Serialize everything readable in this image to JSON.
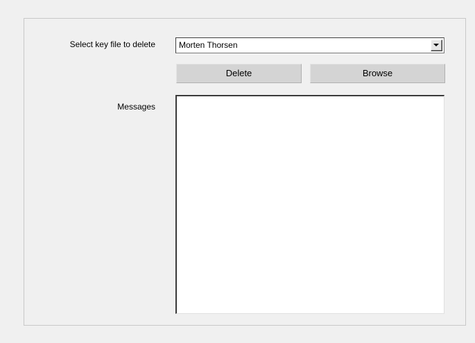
{
  "form": {
    "select_label": "Select key file to delete",
    "selected_key": "Morten Thorsen",
    "delete_label": "Delete",
    "browse_label": "Browse",
    "messages_label": "Messages",
    "messages_text": ""
  }
}
